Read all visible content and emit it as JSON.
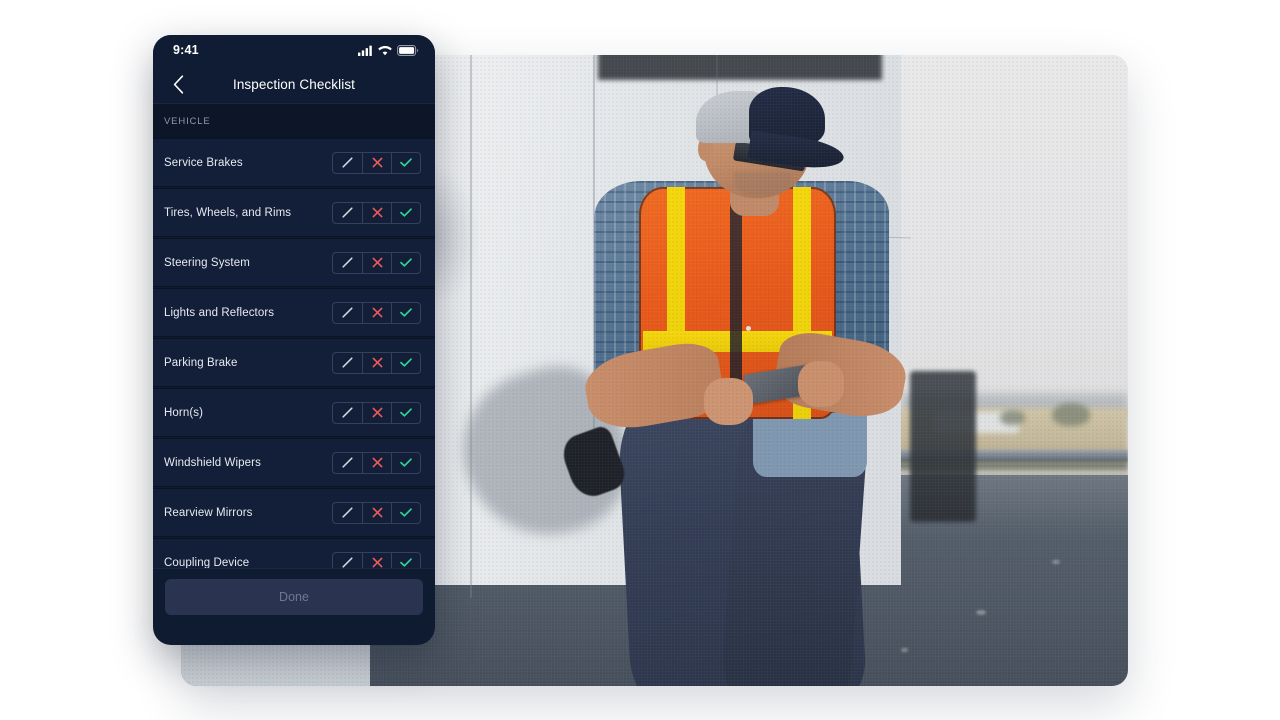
{
  "status_bar": {
    "time": "9:41",
    "signal_icon": "cellular-signal-icon",
    "wifi_icon": "wifi-icon",
    "battery_icon": "battery-full-icon"
  },
  "nav": {
    "back_icon": "chevron-left-icon",
    "title": "Inspection Checklist"
  },
  "section": {
    "label": "VEHICLE"
  },
  "controls": {
    "na_icon": "slash-icon",
    "fail_icon": "x-mark-icon",
    "pass_icon": "check-mark-icon",
    "na_label": "Not Applicable",
    "fail_label": "Defect",
    "pass_label": "Pass"
  },
  "items": [
    {
      "label": "Service Brakes",
      "selected": "none"
    },
    {
      "label": "Tires, Wheels, and Rims",
      "selected": "none"
    },
    {
      "label": "Steering System",
      "selected": "none"
    },
    {
      "label": "Lights and Reflectors",
      "selected": "none"
    },
    {
      "label": "Parking Brake",
      "selected": "none"
    },
    {
      "label": "Horn(s)",
      "selected": "none"
    },
    {
      "label": "Windshield Wipers",
      "selected": "none"
    },
    {
      "label": "Rearview Mirrors",
      "selected": "none"
    },
    {
      "label": "Coupling Device",
      "selected": "none"
    }
  ],
  "footer": {
    "done_label": "Done",
    "done_enabled": false
  },
  "photo": {
    "alt": "Truck driver in orange hi-vis vest leaning against a white trailer using a phone"
  },
  "colors": {
    "page_background": "#ffffff",
    "phone_background": "#0f1b30",
    "navbar": "#101c33",
    "section_header": "#0d1628",
    "row": "#131f38",
    "row_text": "#e6eaf1",
    "section_text": "#8e99ad",
    "segment_border": "#35415c",
    "pass_green": "#2ed598",
    "fail_red": "#ef5a5a",
    "na_gray": "#d5dae3",
    "done_fill": "#2a3450",
    "done_text": "#6d7892"
  }
}
